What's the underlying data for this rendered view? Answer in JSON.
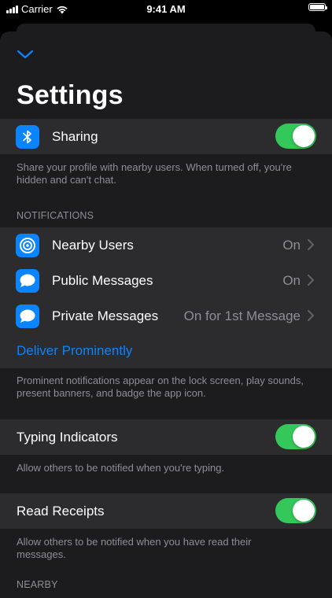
{
  "status_bar": {
    "carrier": "Carrier",
    "time": "9:41 AM"
  },
  "header": {
    "title": "Settings"
  },
  "sharing": {
    "label": "Sharing",
    "enabled": true,
    "footer": "Share your profile with nearby users. When turned off, you're hidden and can't chat."
  },
  "notifications": {
    "header": "NOTIFICATIONS",
    "items": [
      {
        "label": "Nearby Users",
        "value": "On",
        "icon": "target-icon"
      },
      {
        "label": "Public Messages",
        "value": "On",
        "icon": "chat-bubble-icon"
      },
      {
        "label": "Private Messages",
        "value": "On for 1st Message",
        "icon": "chat-bubble-icon"
      }
    ],
    "deliver_label": "Deliver Prominently",
    "footer": "Prominent notifications appear on the lock screen, play sounds, present banners, and badge the app icon."
  },
  "typing_indicators": {
    "label": "Typing Indicators",
    "enabled": true,
    "footer": "Allow others to be notified when you're typing."
  },
  "read_receipts": {
    "label": "Read Receipts",
    "enabled": true,
    "footer": "Allow others to be notified when you have read their messages."
  },
  "nearby": {
    "header": "NEARBY"
  },
  "colors": {
    "accent": "#0a84ff",
    "toggle_on": "#34c759",
    "background": "#1c1c1e",
    "cell": "#2c2c2e"
  }
}
